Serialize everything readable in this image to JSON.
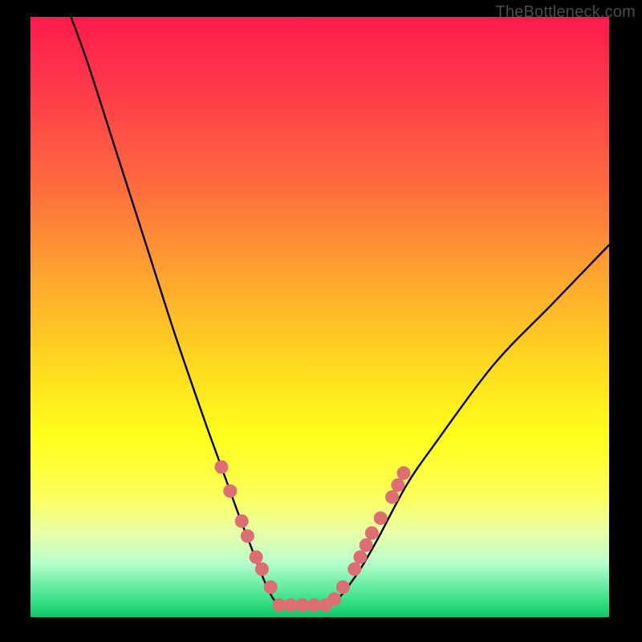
{
  "watermark": "TheBottleneck.com",
  "chart_data": {
    "type": "line",
    "title": "",
    "xlabel": "",
    "ylabel": "",
    "xlim": [
      0,
      100
    ],
    "ylim": [
      0,
      100
    ],
    "background_gradient": {
      "top": "#ff1a4d",
      "bottom": "#10c768",
      "note": "vertical rainbow heat gradient red→orange→yellow→green"
    },
    "series": [
      {
        "name": "bottleneck-curve",
        "note": "V-shaped curve; flat bottom ≈ x 43–52, y ≈ 2. Values estimated from pixel positions (no axes shown).",
        "x": [
          7,
          10,
          15,
          20,
          25,
          30,
          33,
          36,
          38,
          40,
          42,
          44,
          46,
          48,
          50,
          52,
          54,
          57,
          60,
          65,
          70,
          80,
          90,
          100
        ],
        "y": [
          100,
          92,
          77,
          62,
          47,
          33,
          25,
          17,
          12,
          7,
          3,
          2,
          2,
          2,
          2,
          2,
          4,
          8,
          13,
          22,
          29,
          42,
          52,
          62
        ]
      }
    ],
    "markers": {
      "name": "highlight-points",
      "note": "Salmon-colored circular markers along lower part of both arms and flat trough",
      "points": [
        {
          "x": 33.0,
          "y": 25.0
        },
        {
          "x": 34.5,
          "y": 21.0
        },
        {
          "x": 36.5,
          "y": 16.0
        },
        {
          "x": 37.5,
          "y": 13.5
        },
        {
          "x": 39.0,
          "y": 10.0
        },
        {
          "x": 40.0,
          "y": 8.0
        },
        {
          "x": 41.5,
          "y": 5.0
        },
        {
          "x": 43.0,
          "y": 2.0
        },
        {
          "x": 45.0,
          "y": 2.0
        },
        {
          "x": 47.0,
          "y": 2.0
        },
        {
          "x": 49.0,
          "y": 2.0
        },
        {
          "x": 51.0,
          "y": 2.0
        },
        {
          "x": 52.5,
          "y": 3.0
        },
        {
          "x": 54.0,
          "y": 5.0
        },
        {
          "x": 56.0,
          "y": 8.0
        },
        {
          "x": 57.0,
          "y": 10.0
        },
        {
          "x": 58.0,
          "y": 12.0
        },
        {
          "x": 59.0,
          "y": 14.0
        },
        {
          "x": 60.5,
          "y": 16.5
        },
        {
          "x": 62.5,
          "y": 20.0
        },
        {
          "x": 63.5,
          "y": 22.0
        },
        {
          "x": 64.5,
          "y": 24.0
        }
      ]
    },
    "colors": {
      "curve": "#000000",
      "markers": "#dd6e73"
    }
  }
}
